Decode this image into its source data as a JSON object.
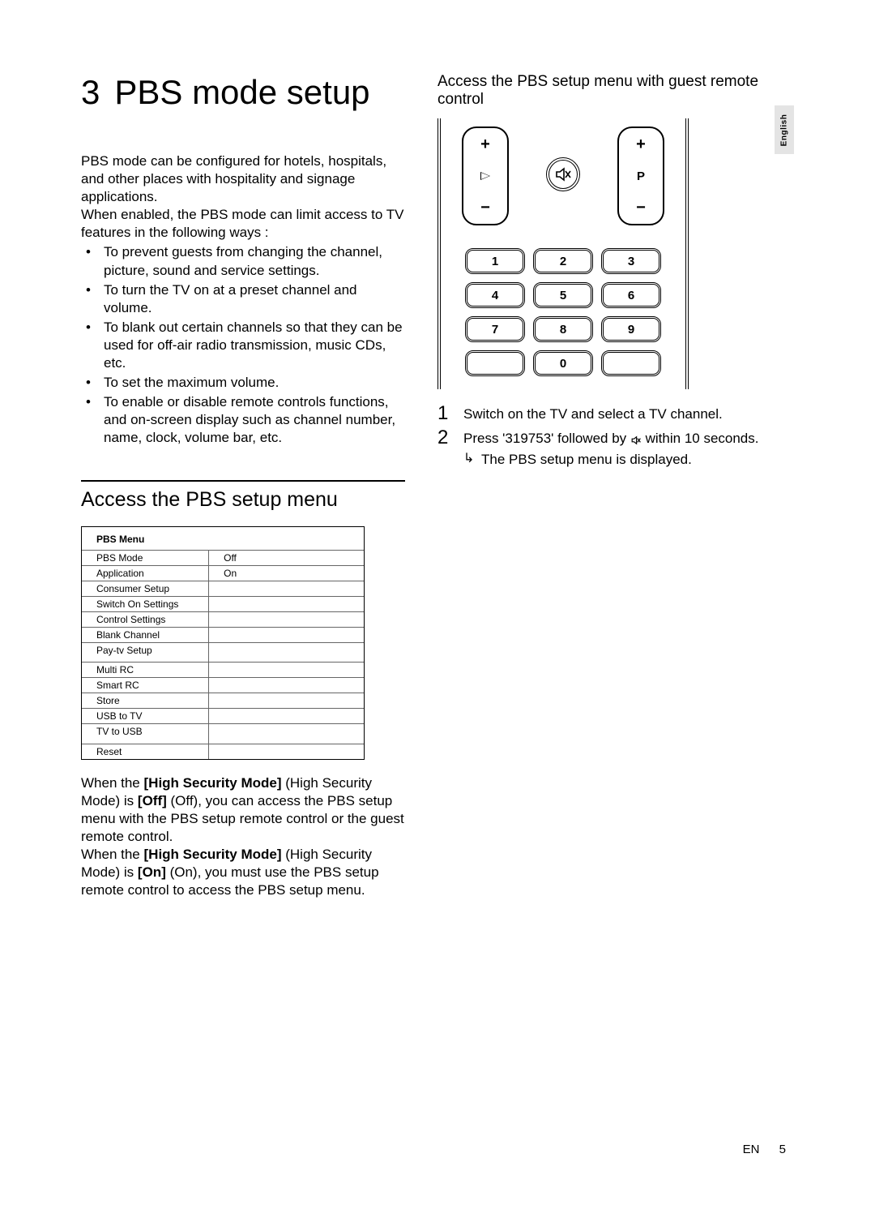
{
  "chapter": {
    "num": "3",
    "title": "PBS mode setup"
  },
  "intro": {
    "p1": "PBS mode can be configured for hotels, hospitals, and other places with hospitality and signage applications.",
    "p2": "When enabled, the PBS mode can limit access to TV features in the following ways :"
  },
  "bullets": [
    "To prevent guests from changing the channel, picture, sound and service settings.",
    "To turn the TV on at a preset channel and volume.",
    "To blank out certain channels so that they can be used for off-air radio transmission, music CDs, etc.",
    "To set the maximum volume.",
    "To enable or disable remote controls functions, and on-screen display such as channel number, name, clock, volume bar, etc."
  ],
  "section1": {
    "heading": "Access the PBS setup menu",
    "menu_title": "PBS Menu",
    "rows": [
      {
        "label": "PBS Mode",
        "value": "Off"
      },
      {
        "label": "Application",
        "value": "On"
      },
      {
        "label": "Consumer Setup",
        "value": ""
      },
      {
        "label": "Switch On Settings",
        "value": ""
      },
      {
        "label": "Control Settings",
        "value": ""
      },
      {
        "label": "Blank Channel",
        "value": ""
      },
      {
        "label": "Pay-tv Setup",
        "value": ""
      },
      {
        "label": "Multi RC",
        "value": ""
      },
      {
        "label": "Smart RC",
        "value": ""
      },
      {
        "label": "Store",
        "value": ""
      },
      {
        "label": "USB to TV",
        "value": ""
      },
      {
        "label": "TV to USB",
        "value": ""
      },
      {
        "label": "Reset",
        "value": ""
      }
    ],
    "note": {
      "sentence1_pre": "When the ",
      "hsm_bold": "[High Security Mode]",
      "hsm_plain": " (High Security Mode) is ",
      "off_bold": "[Off]",
      "off_plain": " (Off), you can access the PBS setup menu with the PBS setup remote control or the guest remote control.",
      "sentence2_pre": "When the ",
      "on_bold": "[On]",
      "on_plain": " (On), you must use the PBS setup remote control to access the PBS setup menu."
    }
  },
  "section2": {
    "heading": "Access the PBS setup menu with guest remote control",
    "remote": {
      "vol_plus": "+",
      "vol_minus": "−",
      "vol_label": "◿",
      "p_label": "P",
      "mute_glyph": "✕",
      "keys": [
        "1",
        "2",
        "3",
        "4",
        "5",
        "6",
        "7",
        "8",
        "9",
        "",
        "0",
        ""
      ]
    },
    "steps": [
      {
        "num": "1",
        "text": "Switch on the TV and select a TV channel."
      },
      {
        "num": "2",
        "text_pre": "Press '319753' followed by ",
        "text_post": " within 10 seconds.",
        "sub": "The PBS setup menu is displayed."
      }
    ]
  },
  "lang_tab": "English",
  "footer": {
    "lang": "EN",
    "page": "5"
  }
}
